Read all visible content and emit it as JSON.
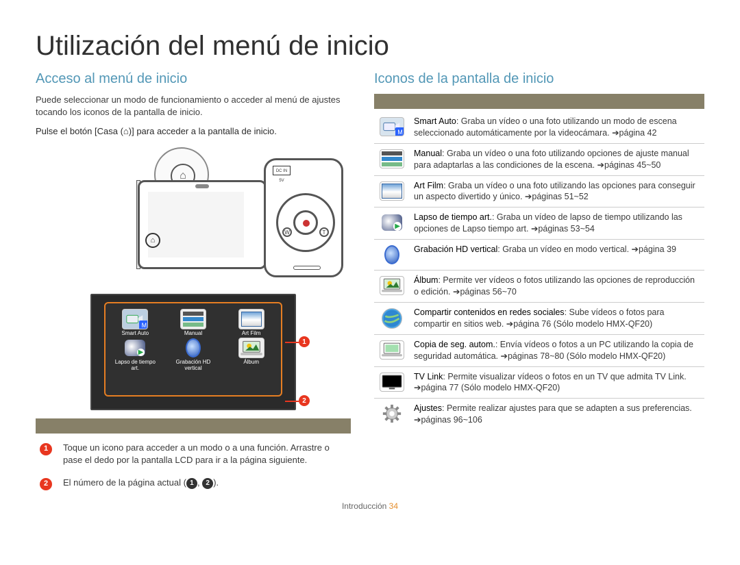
{
  "title": "Utilización del menú de inicio",
  "left": {
    "heading": "Acceso al menú de inicio",
    "intro": "Puede seleccionar un modo de funcionamiento o acceder al menú de ajustes tocando los iconos de la pantalla de inicio.",
    "step_prefix": "Pulse el botón [Casa (",
    "step_suffix": ")] para acceder a la pantalla de inicio.",
    "diagram_port_label": "DC IN 5V",
    "zoom_w": "W",
    "zoom_t": "T",
    "home_glyph": "⌂",
    "home_grid": [
      {
        "label": "Smart Auto"
      },
      {
        "label": "Manual"
      },
      {
        "label": "Art Film"
      },
      {
        "label": "Lapso de tiempo art."
      },
      {
        "label": "Grabación HD vertical"
      },
      {
        "label": "Álbum"
      }
    ],
    "markers": {
      "m1": "1",
      "m2": "2"
    },
    "legend": [
      {
        "num": "1",
        "text": "Toque un icono para acceder a un modo o a una función. Arrastre o pase el dedo por la pantalla LCD para ir a la página siguiente."
      },
      {
        "num": "2",
        "text_prefix": "El número de la página actual (",
        "b1": "1",
        "sep": ", ",
        "b2": "2",
        "text_suffix": ")."
      }
    ]
  },
  "right": {
    "heading": "Iconos de la pantalla de inicio",
    "rows": [
      {
        "icon": "smart-auto",
        "term": "Smart Auto",
        "desc": ": Graba un vídeo o una foto utilizando un modo de escena seleccionado automáticamente por la videocámara. ",
        "ref": "➔página 42"
      },
      {
        "icon": "manual",
        "term": "Manual",
        "desc": ": Graba un vídeo o una foto utilizando opciones de ajuste manual para adaptarlas a las condiciones de la escena. ",
        "ref": "➔páginas 45~50"
      },
      {
        "icon": "art-film",
        "term": "Art Film",
        "desc": ": Graba un vídeo o una foto utilizando las opciones para conseguir un aspecto divertido y único. ",
        "ref": "➔páginas 51~52"
      },
      {
        "icon": "art-timelapse",
        "term": "Lapso de tiempo art.",
        "desc": ": Graba un vídeo de lapso de tiempo utilizando las opciones de Lapso tiempo art. ",
        "ref": "➔páginas 53~54"
      },
      {
        "icon": "vertical-hd",
        "term": "Grabación HD vertical",
        "desc": ": Graba un vídeo en modo vertical. ",
        "ref": "➔página 39"
      },
      {
        "icon": "album",
        "term": "Álbum",
        "desc": ": Permite ver vídeos o fotos utilizando las opciones de reproducción o edición. ",
        "ref": "➔páginas 56~70"
      },
      {
        "icon": "social-share",
        "term": "Compartir contenidos en redes sociales",
        "desc": ": Sube vídeos o fotos para compartir en sitios web. ",
        "ref": "➔página 76 (Sólo modelo HMX-QF20)"
      },
      {
        "icon": "auto-backup",
        "term": "Copia de seg. autom.",
        "desc": ": Envía vídeos o fotos a un PC utilizando la copia de seguridad automática. ",
        "ref": "➔páginas 78~80 (Sólo modelo HMX-QF20)"
      },
      {
        "icon": "tv-link",
        "term": "TV Link",
        "desc": ": Permite visualizar vídeos o fotos en un TV que admita TV Link. ",
        "ref": "➔página 77 (Sólo modelo HMX-QF20)"
      },
      {
        "icon": "settings",
        "term": "Ajustes",
        "desc": ": Permite realizar ajustes para que se adapten a sus preferencias. ",
        "ref": "➔páginas 96~106"
      }
    ]
  },
  "footer": {
    "section": "Introducción",
    "page": "34"
  }
}
